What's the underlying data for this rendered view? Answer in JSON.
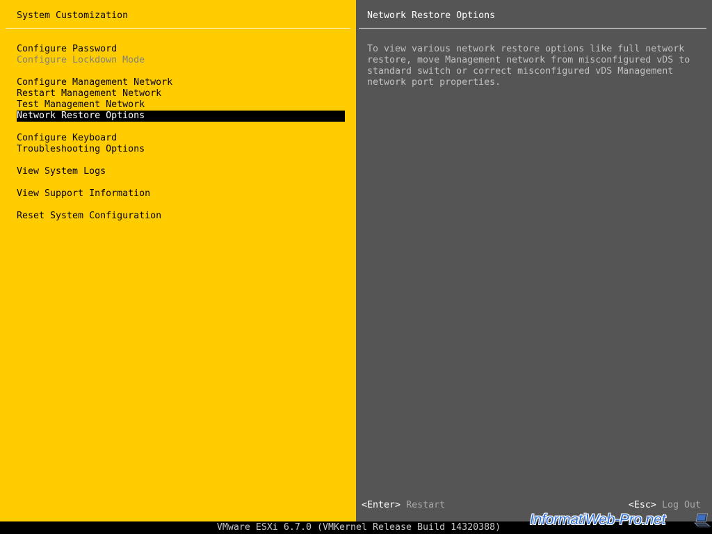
{
  "colors": {
    "left_bg": "#FFCC00",
    "right_bg": "#555555",
    "status_bar_bg": "#000000",
    "disabled_text": "#808080",
    "description_text": "#C0C0C0",
    "watermark": "#2E6FD8"
  },
  "left_panel": {
    "title": "System Customization",
    "menu": [
      {
        "label": "Configure Password"
      },
      {
        "label": "Configure Lockdown Mode",
        "disabled": true
      },
      {
        "label": "Configure Management Network"
      },
      {
        "label": "Restart Management Network"
      },
      {
        "label": "Test Management Network"
      },
      {
        "label": "Network Restore Options",
        "selected": true
      },
      {
        "label": "Configure Keyboard"
      },
      {
        "label": "Troubleshooting Options"
      },
      {
        "label": "View System Logs"
      },
      {
        "label": "View Support Information"
      },
      {
        "label": "Reset System Configuration"
      }
    ]
  },
  "right_panel": {
    "title": "Network Restore Options",
    "description_lines": [
      "To view various network restore options like full network",
      "restore, move Management network from misconfigured vDS to",
      "standard switch or correct misconfigured vDS Management",
      "network port properties."
    ]
  },
  "footer": {
    "enter_key": "<Enter>",
    "enter_action": "Restart",
    "esc_key": "<Esc>",
    "esc_action": "Log Out"
  },
  "status_bar": {
    "text": "VMware ESXi 6.7.0 (VMKernel Release Build 14320388)"
  },
  "watermark": {
    "text": "InformatiWeb-Pro.net",
    "icon": "laptop-icon"
  }
}
